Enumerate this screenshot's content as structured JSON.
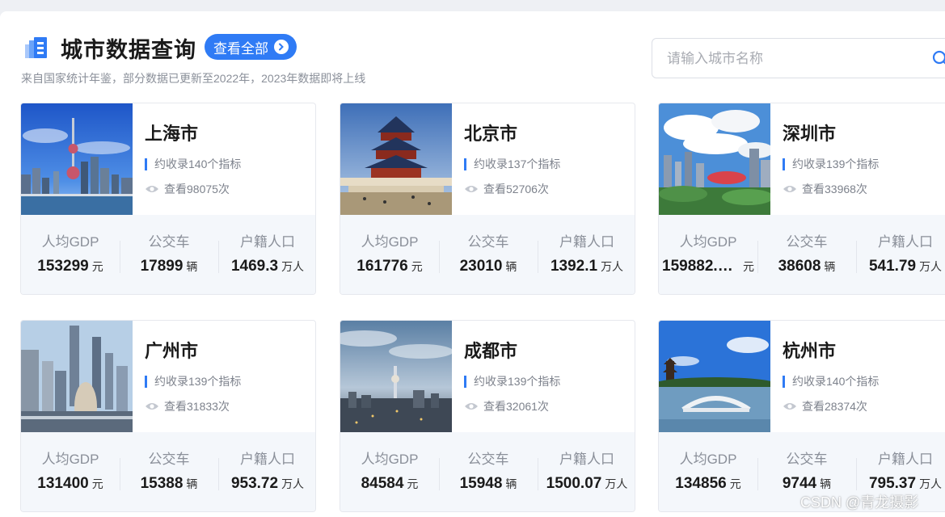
{
  "header": {
    "title": "城市数据查询",
    "view_all_label": "查看全部",
    "subtitle": "来自国家统计年鉴，部分数据已更新至2022年，2023年数据即将上线"
  },
  "search": {
    "placeholder": "请输入城市名称",
    "value": ""
  },
  "stat_labels": {
    "gdp": "人均GDP",
    "bus": "公交车",
    "pop": "户籍人口"
  },
  "units": {
    "gdp": "元",
    "bus": "辆",
    "pop": "万人"
  },
  "cities": [
    {
      "name": "上海市",
      "indicators": "约收录140个指标",
      "views": "查看98075次",
      "gdp": "153299",
      "bus": "17899",
      "pop": "1469.3"
    },
    {
      "name": "北京市",
      "indicators": "约收录137个指标",
      "views": "查看52706次",
      "gdp": "161776",
      "bus": "23010",
      "pop": "1392.1"
    },
    {
      "name": "深圳市",
      "indicators": "约收录139个指标",
      "views": "查看33968次",
      "gdp": "159882.5…",
      "bus": "38608",
      "pop": "541.79"
    },
    {
      "name": "广州市",
      "indicators": "约收录139个指标",
      "views": "查看31833次",
      "gdp": "131400",
      "bus": "15388",
      "pop": "953.72"
    },
    {
      "name": "成都市",
      "indicators": "约收录139个指标",
      "views": "查看32061次",
      "gdp": "84584",
      "bus": "15948",
      "pop": "1500.07"
    },
    {
      "name": "杭州市",
      "indicators": "约收录140个指标",
      "views": "查看28374次",
      "gdp": "134856",
      "bus": "9744",
      "pop": "795.37"
    }
  ],
  "watermark": "CSDN @青龙摄影",
  "colors": {
    "accent": "#2f7bf5",
    "stats_bg": "#f4f7fb"
  }
}
